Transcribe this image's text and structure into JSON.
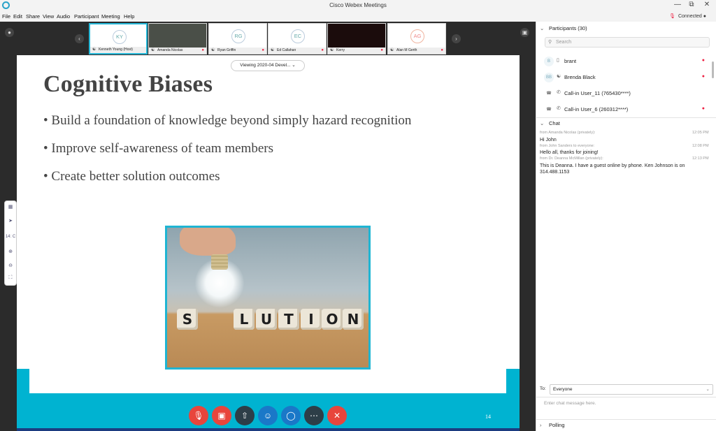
{
  "window": {
    "title": "Cisco Webex Meetings",
    "status": "Connected",
    "controls": [
      "—",
      "⧉",
      "✕"
    ]
  },
  "menu": [
    "File",
    "Edit",
    "Share",
    "View",
    "Audio",
    "Participant",
    "Meeting",
    "Help"
  ],
  "filmstrip": [
    {
      "initials": "KY",
      "name": "Kenneth Young (Host)",
      "active": true,
      "kind": "avatar"
    },
    {
      "initials": "",
      "name": "Amanda Nicolas",
      "active": false,
      "kind": "video"
    },
    {
      "initials": "RG",
      "name": "Ryan Griffin",
      "active": false,
      "kind": "avatar"
    },
    {
      "initials": "EC",
      "name": "Ed Callahan",
      "active": false,
      "kind": "avatar"
    },
    {
      "initials": "",
      "name": "Kerry",
      "active": false,
      "kind": "dark"
    },
    {
      "initials": "AG",
      "name": "Alan M Gerth",
      "active": false,
      "kind": "avatar"
    }
  ],
  "viewing": "Viewing 2020-04 Devel...",
  "slide": {
    "title": "Cognitive Biases",
    "bullets": [
      "• Build a foundation of knowledge beyond simply hazard recognition",
      "• Improve self-awareness of team members",
      "• Create better solution outcomes"
    ],
    "dice": [
      "S",
      "L",
      "U",
      "T",
      "I",
      "O",
      "N"
    ],
    "page_number": "14"
  },
  "zoom_toolbar": {
    "page": "14: C"
  },
  "participants": {
    "header": "Participants (30)",
    "search_placeholder": "Search",
    "rows": [
      {
        "avatar": "B",
        "name": "brant",
        "muted": true
      },
      {
        "avatar": "BB",
        "name": "Brenda Black",
        "muted": true
      },
      {
        "avatar": "☎",
        "name": "Call-in User_11 (765430****)",
        "muted": false
      },
      {
        "avatar": "☎",
        "name": "Call-in User_6 (260312****)",
        "muted": true
      }
    ]
  },
  "chat": {
    "header": "Chat",
    "messages": [
      {
        "meta": "from Amanda Nicolas (privately):",
        "time": "12:05 PM",
        "text": "Hi John"
      },
      {
        "meta": "from John Sanders to everyone:",
        "time": "12:08 PM",
        "text": "Hello all, thanks for joining!"
      },
      {
        "meta": "from Dr. Deanna McMillan (privately):",
        "time": "12:13 PM",
        "text": "This is Deanna. I have a guest online by phone. Ken Johnson is on 314.488.1153"
      }
    ],
    "to_label": "To:",
    "to_value": "Everyone",
    "input_placeholder": "Enter chat message here."
  },
  "polling": "Polling",
  "colors": {
    "accent": "#00b3d1",
    "danger": "#e8453c",
    "dark_button": "#2d3e48",
    "blue_button": "#1a78c8"
  }
}
